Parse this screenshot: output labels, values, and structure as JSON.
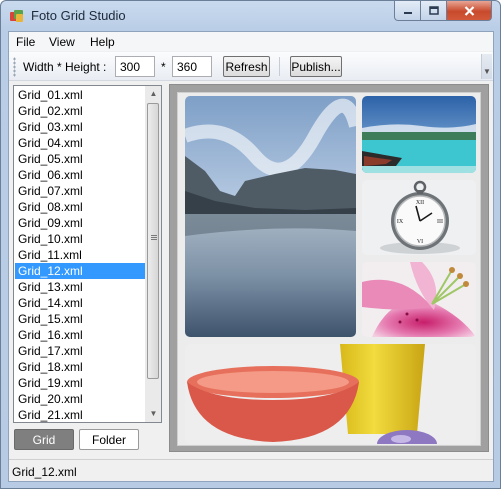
{
  "window": {
    "title": "Foto Grid Studio"
  },
  "menu": {
    "items": [
      "File",
      "View",
      "Help"
    ]
  },
  "toolbar": {
    "size_label": "Width * Height :",
    "width_value": "300",
    "separator": "*",
    "height_value": "360",
    "refresh_label": "Refresh",
    "publish_label": "Publish..."
  },
  "file_list": {
    "items": [
      "Grid_01.xml",
      "Grid_02.xml",
      "Grid_03.xml",
      "Grid_04.xml",
      "Grid_05.xml",
      "Grid_06.xml",
      "Grid_07.xml",
      "Grid_08.xml",
      "Grid_09.xml",
      "Grid_10.xml",
      "Grid_11.xml",
      "Grid_12.xml",
      "Grid_13.xml",
      "Grid_14.xml",
      "Grid_15.xml",
      "Grid_16.xml",
      "Grid_17.xml",
      "Grid_18.xml",
      "Grid_19.xml",
      "Grid_20.xml",
      "Grid_21.xml"
    ],
    "selected": "Grid_12.xml"
  },
  "view_tabs": {
    "grid_label": "Grid",
    "folder_label": "Folder",
    "active": "Grid"
  },
  "status": {
    "text": "Grid_12.xml"
  },
  "colors": {
    "selection": "#3399ff",
    "close_button": "#c84a2c",
    "active_tab": "#7f7f7f"
  }
}
